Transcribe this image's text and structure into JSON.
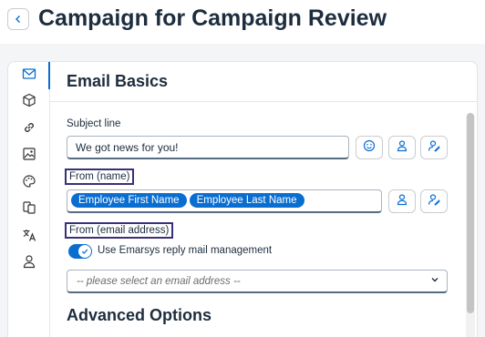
{
  "header": {
    "back_icon": "chevron-left-icon",
    "title": "Campaign for Campaign Review"
  },
  "rail": {
    "items": [
      {
        "name": "email-icon",
        "active": true
      },
      {
        "name": "cube-icon",
        "active": false
      },
      {
        "name": "link-icon",
        "active": false
      },
      {
        "name": "images-icon",
        "active": false
      },
      {
        "name": "palette-icon",
        "active": false
      },
      {
        "name": "copy-icon",
        "active": false
      },
      {
        "name": "translate-icon",
        "active": false
      },
      {
        "name": "person-icon",
        "active": false
      }
    ]
  },
  "section": {
    "title": "Email Basics"
  },
  "subject": {
    "label": "Subject line",
    "value": "We got news for you!",
    "buttons": [
      "emoji-icon",
      "personalize-icon",
      "personalize-edit-icon"
    ]
  },
  "from_name": {
    "label": "From (name)",
    "tokens": [
      "Employee First Name",
      "Employee Last Name"
    ],
    "buttons": [
      "personalize-icon",
      "personalize-edit-icon"
    ]
  },
  "from_email": {
    "label": "From (email address)",
    "toggle_label": "Use Emarsys reply mail management",
    "toggle_on": true,
    "select_placeholder": "-- please select an email address --"
  },
  "advanced": {
    "title": "Advanced Options"
  },
  "colors": {
    "accent": "#0a6ed1",
    "highlight_outline": "#3a2f7a"
  }
}
